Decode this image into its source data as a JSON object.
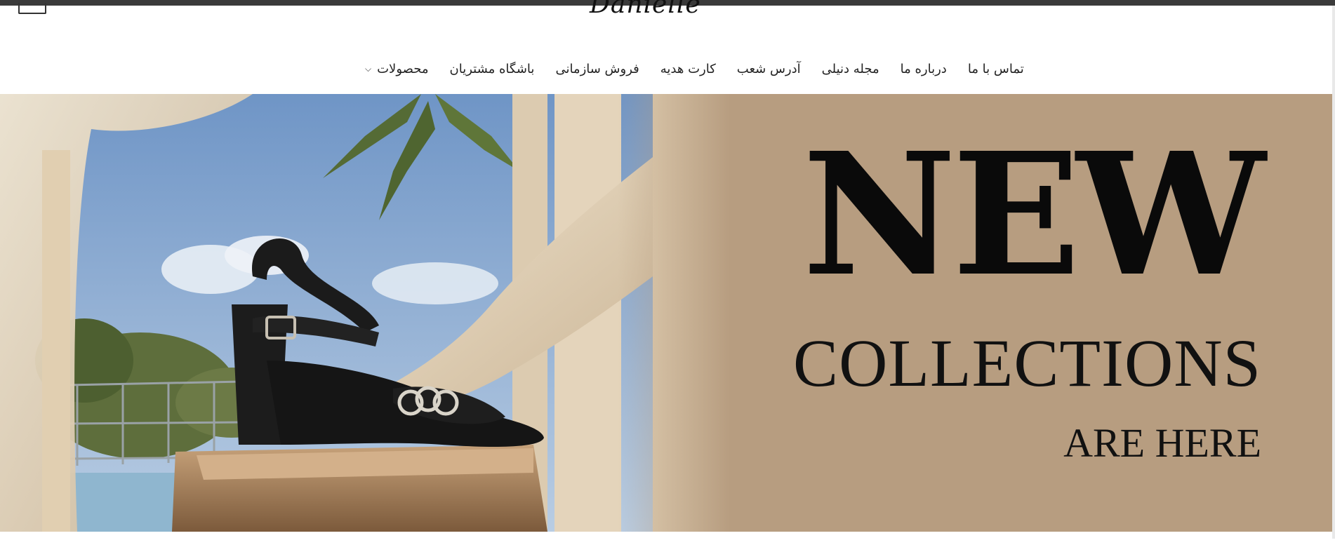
{
  "header": {
    "logo_text": "Danielle",
    "menu_icon": "hamburger-menu-icon"
  },
  "nav": {
    "items": [
      {
        "label": "محصولات",
        "has_dropdown": true
      },
      {
        "label": "باشگاه مشتریان"
      },
      {
        "label": "فروش سازمانی"
      },
      {
        "label": "کارت هدیه"
      },
      {
        "label": "آدرس شعب"
      },
      {
        "label": "مجله دنیلی"
      },
      {
        "label": "درباره ما"
      },
      {
        "label": "تماس با ما"
      }
    ],
    "dropdown_icon": "chevron-down-icon"
  },
  "hero": {
    "line1": "NEW",
    "line2": "COLLECTIONS",
    "line3": "ARE HERE",
    "background_color": "#b79d80",
    "image_subject": "black-heeled-sandal-on-stone"
  }
}
